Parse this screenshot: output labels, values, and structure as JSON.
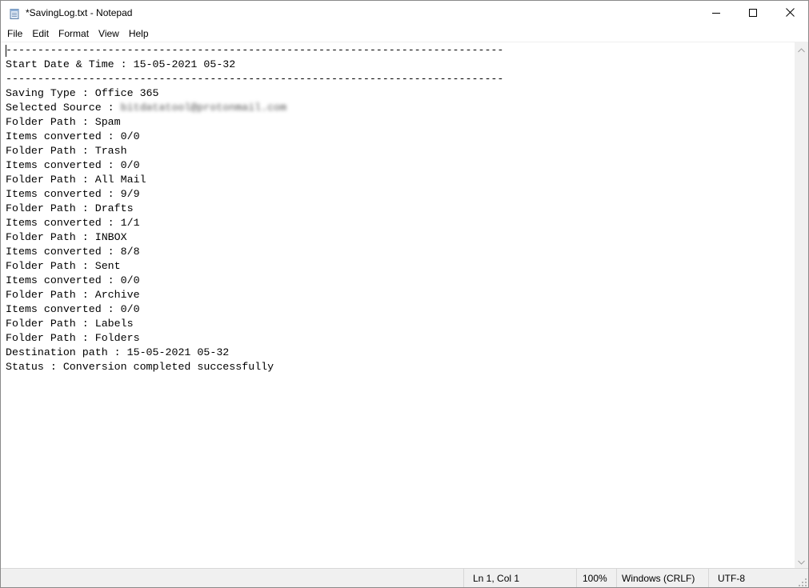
{
  "window": {
    "title": "*SavingLog.txt - Notepad",
    "icon": "notepad-icon",
    "controls": [
      "minimize-icon",
      "maximize-icon",
      "close-icon"
    ]
  },
  "menu": [
    "File",
    "Edit",
    "Format",
    "View",
    "Help"
  ],
  "document": {
    "lines": [
      "------------------------------------------------------------------------------",
      "Start Date & Time : 15-05-2021 05-32",
      "------------------------------------------------------------------------------",
      "Saving Type : Office 365",
      "Selected Source : ",
      "Folder Path : Spam",
      "Items converted : 0/0",
      "Folder Path : Trash",
      "Items converted : 0/0",
      "Folder Path : All Mail",
      "Items converted : 9/9",
      "Folder Path : Drafts",
      "Items converted : 1/1",
      "Folder Path : INBOX",
      "Items converted : 8/8",
      "Folder Path : Sent",
      "Items converted : 0/0",
      "Folder Path : Archive",
      "Items converted : 0/0",
      "Folder Path : Labels",
      "Folder Path : Folders",
      "Destination path : 15-05-2021 05-32",
      "Status : Conversion completed successfully"
    ],
    "redacted_email": "bitdatatool@protonmail.com"
  },
  "status": {
    "position": "Ln 1, Col 1",
    "zoom": "100%",
    "line_endings": "Windows (CRLF)",
    "encoding": "UTF-8"
  }
}
